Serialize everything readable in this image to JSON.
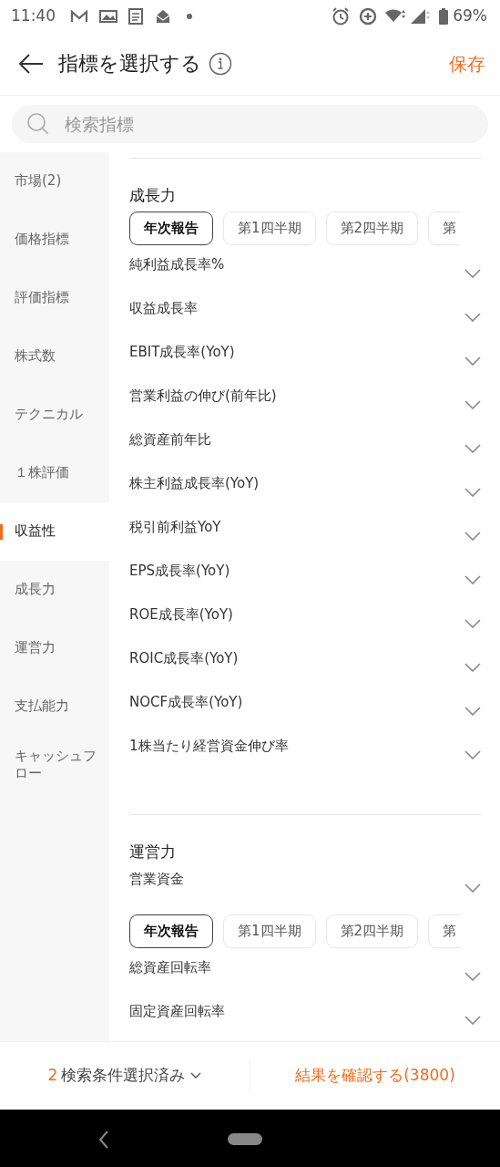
{
  "status_bar": {
    "time": "11:40",
    "battery": "69%"
  },
  "header": {
    "title": "指標を選択する",
    "save": "保存"
  },
  "search": {
    "placeholder": "検索指標"
  },
  "sidebar": {
    "items": [
      {
        "label": "市場(2)",
        "selected": false
      },
      {
        "label": "価格指標",
        "selected": false
      },
      {
        "label": "評価指標",
        "selected": false
      },
      {
        "label": "株式数",
        "selected": false
      },
      {
        "label": "テクニカル",
        "selected": false
      },
      {
        "label": "１株評価",
        "selected": false
      },
      {
        "label": "収益性",
        "selected": true
      },
      {
        "label": "成長力",
        "selected": false
      },
      {
        "label": "運営力",
        "selected": false
      },
      {
        "label": "支払能力",
        "selected": false
      },
      {
        "label": "キャッシュフロー",
        "selected": false
      }
    ]
  },
  "sections": [
    {
      "title": "成長力",
      "blocks": [
        {
          "kind": "chips",
          "chips": [
            {
              "label": "年次報告",
              "selected": true
            },
            {
              "label": "第1四半期",
              "selected": false
            },
            {
              "label": "第2四半期",
              "selected": false
            },
            {
              "label": "第",
              "selected": false
            }
          ]
        },
        {
          "kind": "item",
          "label": "純利益成長率%"
        },
        {
          "kind": "item",
          "label": "収益成長率"
        },
        {
          "kind": "item",
          "label": "EBIT成長率(YoY)"
        },
        {
          "kind": "item",
          "label": "営業利益の伸び(前年比)"
        },
        {
          "kind": "item",
          "label": "総資産前年比"
        },
        {
          "kind": "item",
          "label": "株主利益成長率(YoY)"
        },
        {
          "kind": "item",
          "label": "税引前利益YoY"
        },
        {
          "kind": "item",
          "label": "EPS成長率(YoY)"
        },
        {
          "kind": "item",
          "label": "ROE成長率(YoY)"
        },
        {
          "kind": "item",
          "label": "ROIC成長率(YoY)"
        },
        {
          "kind": "item",
          "label": "NOCF成長率(YoY)"
        },
        {
          "kind": "item",
          "label": "1株当たり経営資金伸び率"
        }
      ]
    },
    {
      "title": "運営力",
      "blocks": [
        {
          "kind": "item",
          "label": "営業資金"
        },
        {
          "kind": "chips",
          "chips": [
            {
              "label": "年次報告",
              "selected": true
            },
            {
              "label": "第1四半期",
              "selected": false
            },
            {
              "label": "第2四半期",
              "selected": false
            },
            {
              "label": "第",
              "selected": false
            }
          ]
        },
        {
          "kind": "item",
          "label": "総資産回転率"
        },
        {
          "kind": "item",
          "label": "固定資産回転率"
        }
      ]
    }
  ],
  "footer": {
    "count": "2",
    "selected_label": "検索条件選択済み",
    "confirm": "結果を確認する(3800)"
  }
}
